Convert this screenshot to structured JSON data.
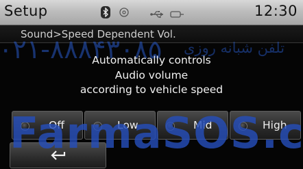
{
  "status_bar": {
    "title": "Setup",
    "time": "12:30",
    "icons": [
      "bluetooth-icon",
      "disc-icon",
      "usb-icon",
      "aux-icon"
    ]
  },
  "breadcrumb": {
    "text": "Sound>Speed Dependent Vol."
  },
  "message": {
    "lines": [
      "Automatically controls",
      "Audio volume",
      "according to vehicle speed"
    ]
  },
  "options": [
    {
      "label": "Off"
    },
    {
      "label": "Low"
    },
    {
      "label": "Mid"
    },
    {
      "label": "High"
    }
  ],
  "back_button": {
    "icon": "back-arrow-icon"
  },
  "watermark": {
    "phone": "۰۲۱-۸۸۸۴۳۰۸۵",
    "phrase": "تلفن شبانه روزی",
    "brand": "FarmaSOS.com"
  },
  "colors": {
    "status_bar_bg": "#bdbdbd",
    "screen_bg": "#050505",
    "watermark_blue": "#264eb9",
    "text_light": "#f2f2f2"
  }
}
